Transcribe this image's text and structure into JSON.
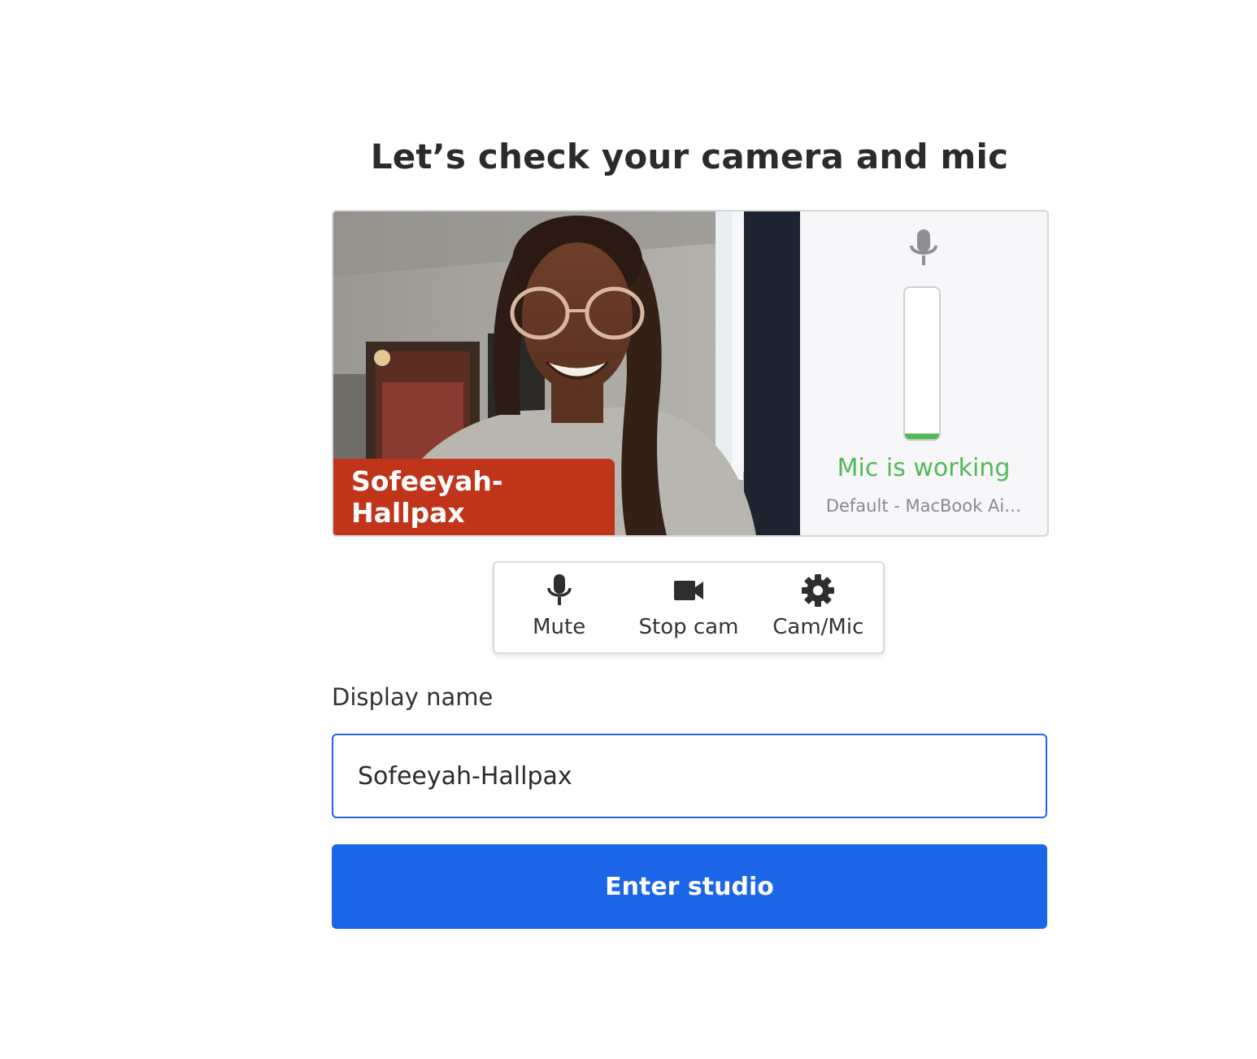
{
  "header": {
    "title": "Let’s check your camera and mic"
  },
  "preview": {
    "participant_name": "Sofeeyah-Hallpax",
    "name_tag_color": "#c0341a"
  },
  "mic_check": {
    "icon": "microphone-icon",
    "level": 0.04,
    "status": "Mic is working",
    "status_color": "#52b955",
    "device": "Default - MacBook Ai…"
  },
  "controls": {
    "mute": {
      "label": "Mute",
      "icon": "microphone-icon"
    },
    "stop_cam": {
      "label": "Stop cam",
      "icon": "video-camera-icon"
    },
    "settings": {
      "label": "Cam/Mic",
      "icon": "gear-icon"
    }
  },
  "form": {
    "display_name_label": "Display name",
    "display_name_value": "Sofeeyah-Hallpax",
    "submit_label": "Enter studio",
    "accent_color": "#1b66e7"
  }
}
